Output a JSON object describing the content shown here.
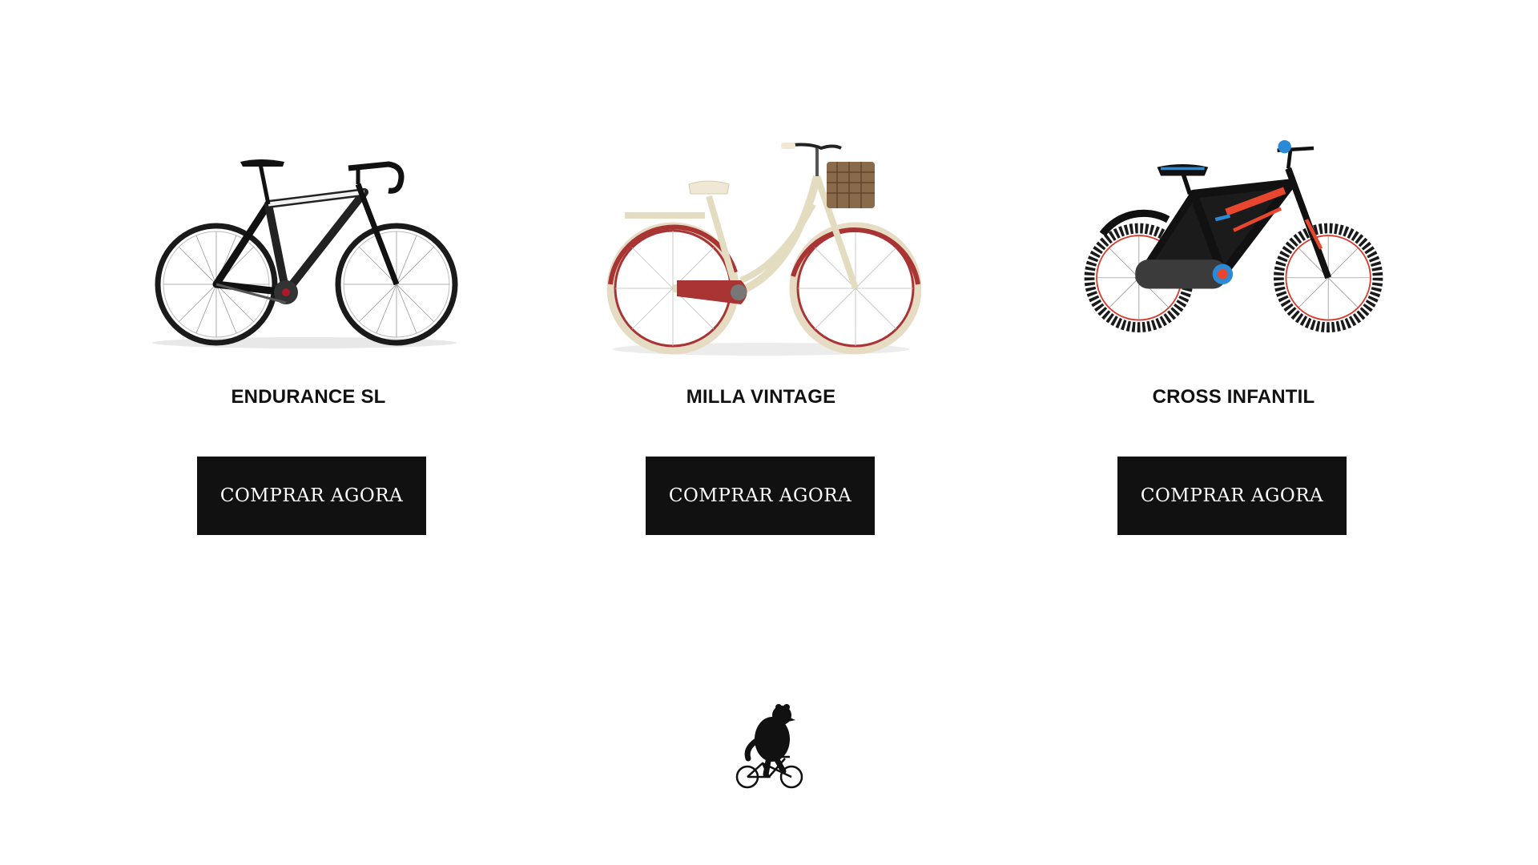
{
  "products": [
    {
      "name": "ENDURANCE SL",
      "button_label": "COMPRAR AGORA",
      "image": "road-bike-black-white"
    },
    {
      "name": "MILLA VINTAGE",
      "button_label": "COMPRAR AGORA",
      "image": "vintage-city-bike-cream-with-basket"
    },
    {
      "name": "CROSS INFANTIL",
      "button_label": "COMPRAR AGORA",
      "image": "kids-bike-black-red-blue"
    }
  ],
  "footer": {
    "logo": "bear-riding-bicycle-logo"
  },
  "colors": {
    "button_bg": "#111111",
    "button_text": "#ffffff",
    "title_text": "#111111",
    "background": "#ffffff"
  }
}
